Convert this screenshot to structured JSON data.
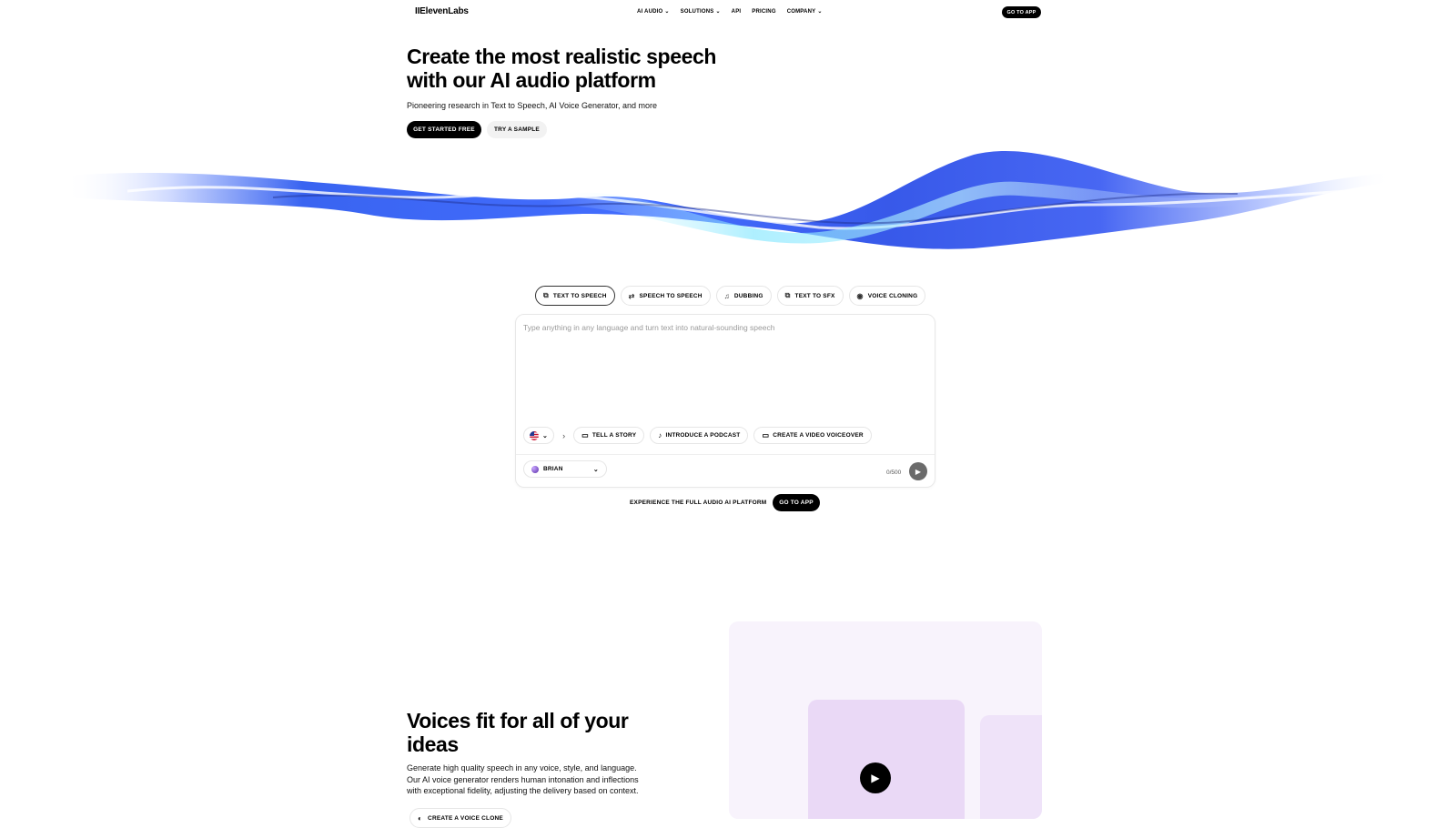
{
  "header": {
    "logo": "IIElevenLabs",
    "nav": [
      {
        "label": "AI AUDIO",
        "dropdown": true
      },
      {
        "label": "SOLUTIONS",
        "dropdown": true
      },
      {
        "label": "API",
        "dropdown": false
      },
      {
        "label": "PRICING",
        "dropdown": false
      },
      {
        "label": "COMPANY",
        "dropdown": true
      }
    ],
    "cta": "GO TO APP"
  },
  "hero": {
    "title_line1": "Create the most realistic speech",
    "title_line2": "with our AI audio platform",
    "subtitle": "Pioneering research in Text to Speech, AI Voice Generator, and more",
    "primary_button": "GET STARTED FREE",
    "secondary_button": "TRY A SAMPLE"
  },
  "tabs": [
    {
      "label": "TEXT TO SPEECH",
      "icon": "text-to-speech-icon",
      "active": true
    },
    {
      "label": "SPEECH TO SPEECH",
      "icon": "speech-to-speech-icon",
      "active": false
    },
    {
      "label": "DUBBING",
      "icon": "dubbing-icon",
      "active": false
    },
    {
      "label": "TEXT TO SFX",
      "icon": "sfx-icon",
      "active": false
    },
    {
      "label": "VOICE CLONING",
      "icon": "voice-cloning-icon",
      "active": false
    }
  ],
  "editor": {
    "placeholder": "Type anything in any language and turn text into natural-sounding speech",
    "language_flag": "us-flag-icon",
    "suggestions": [
      {
        "label": "TELL A STORY",
        "icon": "book-icon"
      },
      {
        "label": "INTRODUCE A PODCAST",
        "icon": "microphone-icon"
      },
      {
        "label": "CREATE A VIDEO VOICEOVER",
        "icon": "video-icon"
      }
    ],
    "voice": "BRIAN",
    "counter": "0/500"
  },
  "cta_row": {
    "text": "EXPERIENCE THE FULL AUDIO AI PLATFORM",
    "button": "GO TO APP"
  },
  "section": {
    "title_line1": "Voices fit for all of your",
    "title_line2": "ideas",
    "body_line1": "Generate high quality speech in any voice, style, and language.",
    "body_line2": "Our AI voice generator renders human intonation and inflections",
    "body_line3": "with exceptional fidelity, adjusting the delivery based on context.",
    "button": "CREATE A VOICE CLONE"
  },
  "colors": {
    "accent": "#000000",
    "wave_blue": "#2f5cf0",
    "wave_cyan": "#7fe6ff",
    "panel_bg": "#f8f3fc",
    "card_bg": "#ead9f6"
  }
}
